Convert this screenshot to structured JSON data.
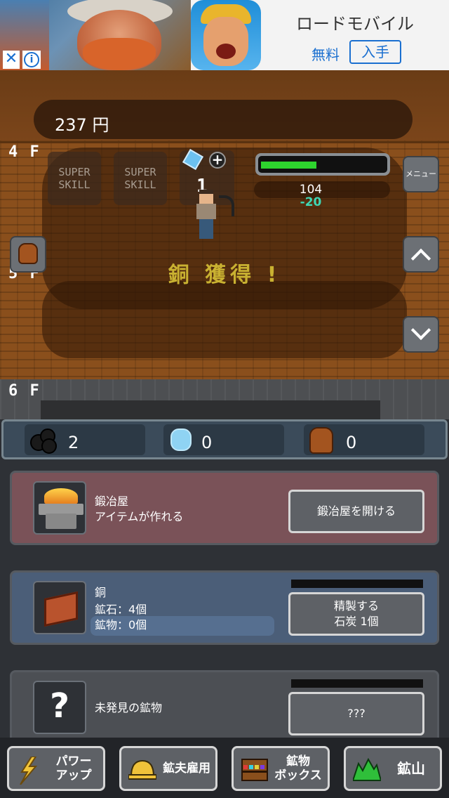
{
  "ad": {
    "app_name": "ロードモバイル",
    "price": "無料",
    "get_label": "入手",
    "close_glyph": "✕",
    "info_glyph": "i"
  },
  "game": {
    "money": "237 円",
    "floors": [
      "4 F",
      "5 F",
      "6 F"
    ],
    "skills": [
      "SUPER\nSKILL",
      "SUPER\nSKILL"
    ],
    "miner_level": "1",
    "hp_value": "104",
    "damage": "-20",
    "hp_fraction": 0.45,
    "menu_label": "メニュー",
    "acquired_text": "銅 獲得 !"
  },
  "inventory": {
    "coal": "2",
    "gems": "0",
    "bags": "0"
  },
  "cards": {
    "smithy": {
      "title": "鍛冶屋",
      "subtitle": "アイテムが作れる",
      "button": "鍛冶屋を開ける"
    },
    "copper": {
      "title": "銅",
      "ore": "鉱石：4個",
      "mineral": "鉱物：0個",
      "button_line1": "精製する",
      "button_line2": "石炭 1個"
    },
    "unknown": {
      "title": "未発見の鉱物",
      "icon_glyph": "?",
      "button": "???"
    }
  },
  "nav": {
    "power_line1": "パワー",
    "power_line2": "アップ",
    "hire": "鉱夫雇用",
    "box_line1": "鉱物",
    "box_line2": "ボックス",
    "mine": "鉱山"
  },
  "colors": {
    "hp_green": "#2ed42e",
    "damage_teal": "#3fd7b5",
    "acquired_gold": "#c9b131",
    "ad_blue": "#1a6fd0"
  }
}
